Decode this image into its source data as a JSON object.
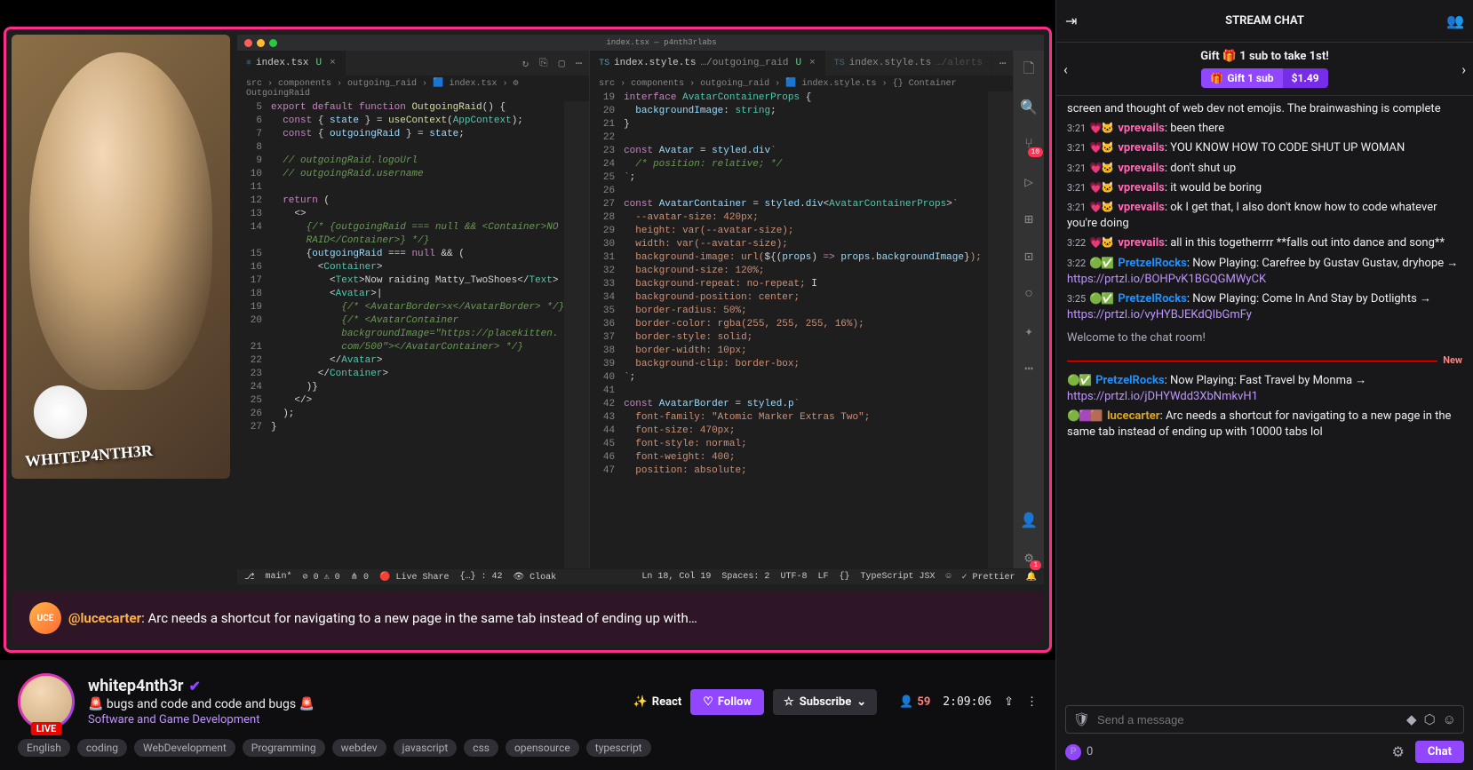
{
  "streamer": {
    "name": "whitep4nth3r",
    "title": "🚨 bugs and code and code and bugs 🚨",
    "category": "Software and Game Development",
    "live": "LIVE",
    "logoText": "WHITEP4NTH3R"
  },
  "actions": {
    "react": "React",
    "follow": "Follow",
    "subscribe": "Subscribe"
  },
  "stats": {
    "viewers": "59",
    "uptime": "2:09:06"
  },
  "tags": [
    "English",
    "coding",
    "WebDevelopment",
    "Programming",
    "webdev",
    "javascript",
    "css",
    "opensource",
    "typescript"
  ],
  "editor": {
    "windowTitle": "index.tsx — p4nth3rlabs",
    "tabs": {
      "left": {
        "name": "index.tsx",
        "status": "U"
      },
      "right1": {
        "name": "index.style.ts",
        "path": "…/outgoing_raid",
        "status": "U"
      },
      "right2": {
        "name": "index.style.ts",
        "path": "…/alerts"
      }
    },
    "breadcrumb": {
      "left": "src › components › outgoing_raid › 🟦 index.tsx › ⚙ OutgoingRaid",
      "right": "src › components › outgoing_raid › 🟦 index.style.ts › {} Container"
    },
    "statusbar": {
      "branch": "main*",
      "errors": "⊘ 0 ⚠ 0",
      "ports": "⋔ 0",
      "liveShare": "Live Share",
      "braces": "{…} : 42",
      "cloak": "Cloak",
      "cursor": "Ln 18, Col 19",
      "spaces": "Spaces: 2",
      "encoding": "UTF-8",
      "eol": "LF",
      "lang": "TypeScript JSX",
      "prettier": "✓ Prettier"
    }
  },
  "featured": {
    "user": "@lucecarter",
    "text": ": Arc needs a shortcut for navigating to a new page in the same tab instead of ending up with…"
  },
  "chat": {
    "header": "STREAM CHAT",
    "gift": {
      "text": "Gift 🎁 1 sub to take 1st!",
      "button": "Gift 1 sub",
      "price": "$1.49"
    },
    "messages": [
      {
        "ts": "",
        "badges": "",
        "user": "",
        "color": "",
        "text": "screen and thought of web dev not emojis. The brainwashing is complete",
        "continuation": true
      },
      {
        "ts": "3:21",
        "badges": "💗🐱",
        "user": "vprevails",
        "color": "#ff69b4",
        "text": "been there"
      },
      {
        "ts": "3:21",
        "badges": "💗🐱",
        "user": "vprevails",
        "color": "#ff69b4",
        "text": "YOU KNOW HOW TO CODE SHUT UP WOMAN"
      },
      {
        "ts": "3:21",
        "badges": "💗🐱",
        "user": "vprevails",
        "color": "#ff69b4",
        "text": "don't shut up"
      },
      {
        "ts": "3:21",
        "badges": "💗🐱",
        "user": "vprevails",
        "color": "#ff69b4",
        "text": "it would be boring"
      },
      {
        "ts": "3:21",
        "badges": "💗🐱",
        "user": "vprevails",
        "color": "#ff69b4",
        "text": "ok I get that, I also don't know how to code whatever you're doing"
      },
      {
        "ts": "3:22",
        "badges": "💗🐱",
        "user": "vprevails",
        "color": "#ff69b4",
        "text": "all in this togetherrrr **falls out into dance and song**"
      },
      {
        "ts": "3:22",
        "badges": "🟢✅",
        "user": "PretzelRocks",
        "color": "#1e90ff",
        "text": "Now Playing: Carefree by Gustav Gustav, dryhope → ",
        "link": "https://prtzl.io/BOHPvK1BGQGMWyCK"
      },
      {
        "ts": "3:25",
        "badges": "🟢✅",
        "user": "PretzelRocks",
        "color": "#1e90ff",
        "text": "Now Playing: Come In And Stay by Dotlights → ",
        "link": "https://prtzl.io/vyHYBJEKdQIbGmFy"
      }
    ],
    "welcome": "Welcome to the chat room!",
    "newLabel": "New",
    "newMessages": [
      {
        "badges": "🟢✅",
        "user": "PretzelRocks",
        "color": "#1e90ff",
        "text": "Now Playing: Fast Travel by Monma → ",
        "link": "https://prtzl.io/jDHYWdd3XbNmkvH1"
      },
      {
        "badges": "🟢🟪🟫",
        "user": "lucecarter",
        "color": "#daa520",
        "text": "Arc needs a shortcut for navigating to a new page in the same tab instead of ending up with 10000 tabs lol"
      }
    ],
    "input": {
      "placeholder": "Send a message"
    },
    "points": "0",
    "sendButton": "Chat"
  }
}
